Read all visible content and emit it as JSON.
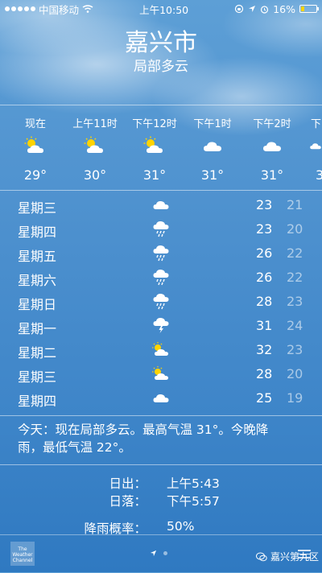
{
  "status_bar": {
    "carrier": "中国移动",
    "time": "上午10:50",
    "battery": "16%"
  },
  "header": {
    "city": "嘉兴市",
    "condition": "局部多云"
  },
  "hourly": [
    {
      "time": "现在",
      "icon": "partly-sunny-icon",
      "temp": "29°"
    },
    {
      "time": "上午11时",
      "icon": "partly-sunny-icon",
      "temp": "30°"
    },
    {
      "time": "下午12时",
      "icon": "partly-sunny-icon",
      "temp": "31°"
    },
    {
      "time": "下午1时",
      "icon": "cloud-icon",
      "temp": "31°"
    },
    {
      "time": "下午2时",
      "icon": "cloud-icon",
      "temp": "31°"
    },
    {
      "time": "下",
      "icon": "cloud-icon",
      "temp": "3"
    }
  ],
  "daily": [
    {
      "day": "星期三",
      "icon": "cloud-icon",
      "high": "23",
      "low": "21"
    },
    {
      "day": "星期四",
      "icon": "rain-icon",
      "high": "23",
      "low": "20"
    },
    {
      "day": "星期五",
      "icon": "rain-icon",
      "high": "26",
      "low": "22"
    },
    {
      "day": "星期六",
      "icon": "rain-icon",
      "high": "26",
      "low": "22"
    },
    {
      "day": "星期日",
      "icon": "rain-icon",
      "high": "28",
      "low": "23"
    },
    {
      "day": "星期一",
      "icon": "thunderstorm-icon",
      "high": "31",
      "low": "24"
    },
    {
      "day": "星期二",
      "icon": "partly-sunny-icon",
      "high": "32",
      "low": "23"
    },
    {
      "day": "星期三",
      "icon": "partly-sunny-icon",
      "high": "28",
      "low": "20"
    },
    {
      "day": "星期四",
      "icon": "cloud-icon",
      "high": "25",
      "low": "19"
    }
  ],
  "summary": {
    "line1": "今天：现在局部多云。最高气温 31°。今晚降",
    "line2": "雨，最低气温 22°。"
  },
  "details": {
    "sunrise_label": "日出：",
    "sunrise_value": "上午5:43",
    "sunset_label": "日落：",
    "sunset_value": "下午5:57",
    "rain_label": "降雨概率：",
    "rain_value": "50%"
  },
  "bottom": {
    "weather_channel_line1": "The",
    "weather_channel_line2": "Weather",
    "weather_channel_line3": "Channel",
    "watermark": "嘉兴第九区"
  },
  "colors": {
    "background_top": "#5d9fd6",
    "background_bottom": "#2f79c1",
    "sun": "#ffd400",
    "low_temp": "rgba(255,255,255,0.55)"
  }
}
